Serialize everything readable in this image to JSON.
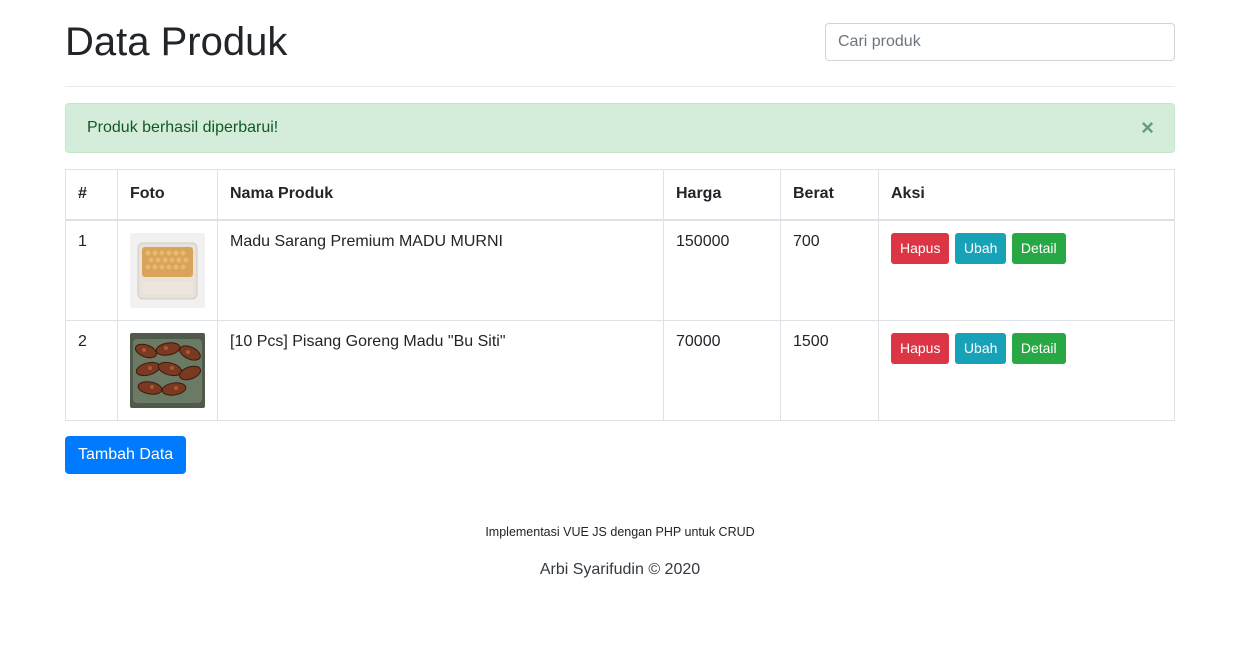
{
  "header": {
    "title": "Data Produk",
    "search_placeholder": "Cari produk"
  },
  "alert": {
    "message": "Produk berhasil diperbarui!",
    "close_symbol": "×",
    "color": "#d4edda"
  },
  "table": {
    "columns": [
      "#",
      "Foto",
      "Nama Produk",
      "Harga",
      "Berat",
      "Aksi"
    ],
    "rows": [
      {
        "no": "1",
        "image": "honeycomb-photo",
        "name": "Madu Sarang Premium MADU MURNI",
        "price": "150000",
        "weight": "700"
      },
      {
        "no": "2",
        "image": "fried-banana-photo",
        "name": "[10 Pcs] Pisang Goreng Madu \"Bu Siti\"",
        "price": "70000",
        "weight": "1500"
      }
    ],
    "actions": {
      "delete": "Hapus",
      "edit": "Ubah",
      "detail": "Detail"
    }
  },
  "add_button": "Tambah Data",
  "footer": {
    "tagline": "Implementasi VUE JS dengan PHP untuk CRUD",
    "credit": "Arbi Syarifudin © 2020"
  },
  "colors": {
    "primary": "#007bff",
    "danger": "#dc3545",
    "info": "#17a2b8",
    "success": "#28a745"
  }
}
